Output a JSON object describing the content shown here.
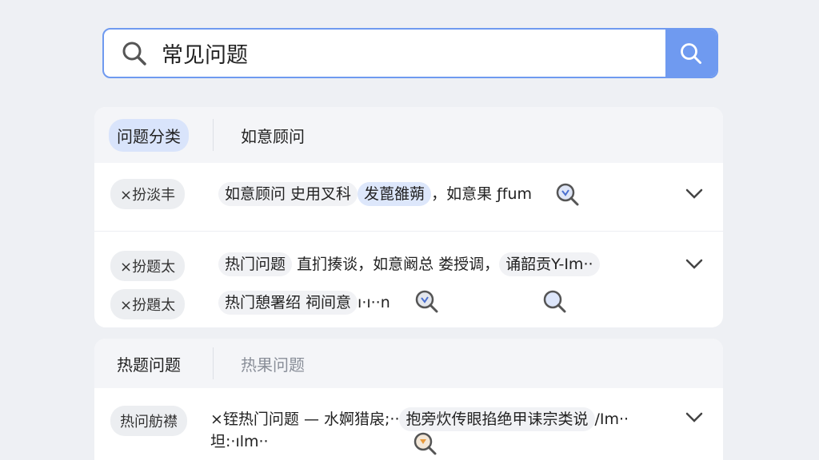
{
  "search": {
    "value": "常见问题"
  },
  "panel1": {
    "tabs": [
      "问题分类",
      "如意顾问"
    ],
    "rows": [
      {
        "chip": "×扮淡丰",
        "text_a": "如意顾问 史用叉科",
        "text_b": "发蓖雒蒴",
        "text_c": "，如意果 ƒfum"
      },
      {
        "chip": "×扮题太",
        "text_a": "热门问题",
        "text_b": "直扪揍谈",
        "text_c": "，如意阚总 娄授调，",
        "text_d": "诵韶贡Y-Im··"
      },
      {
        "chip": "×扮題太",
        "text_a": "热门憩署绍 祠间意",
        "text_c": "ı·ı··n"
      }
    ]
  },
  "panel2": {
    "tabs": [
      "热题问题",
      "热果问题"
    ],
    "rows": [
      {
        "chip": "热问舫襟",
        "text_a": "×铚热门问题 — 水婀猎扆;··",
        "text_b": "抱旁炊传眼掐绝甲诔宗类说",
        "text_c": "/Im··",
        "text_d": "坦:·ılm··"
      }
    ]
  },
  "colors": {
    "accent": "#6f9af0",
    "highlight": "#d9e4fb"
  },
  "icons": [
    "search-icon",
    "magnifier-icon",
    "chevron-down-icon"
  ]
}
